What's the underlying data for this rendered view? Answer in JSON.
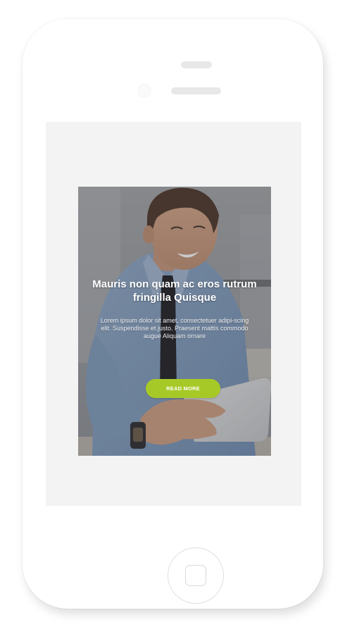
{
  "hero": {
    "title": "Mauris non quam ac eros rutrum fringilla Quisque",
    "body": "Lorem ipsum dolor sit amet, consectetuer adipi-scing elit. Suspendisse et justo. Praesent mattis commodo augue Aliquam ornare",
    "button_label": "READ MORE",
    "image": "man-with-tablet-photo"
  },
  "colors": {
    "accent": "#a7c928",
    "screen_background": "#f3f3f3",
    "phone_body": "#ffffff"
  },
  "icons": {
    "home": "home-button-square-icon",
    "camera": "front-camera-icon",
    "speaker": "earpiece-speaker-icon"
  }
}
